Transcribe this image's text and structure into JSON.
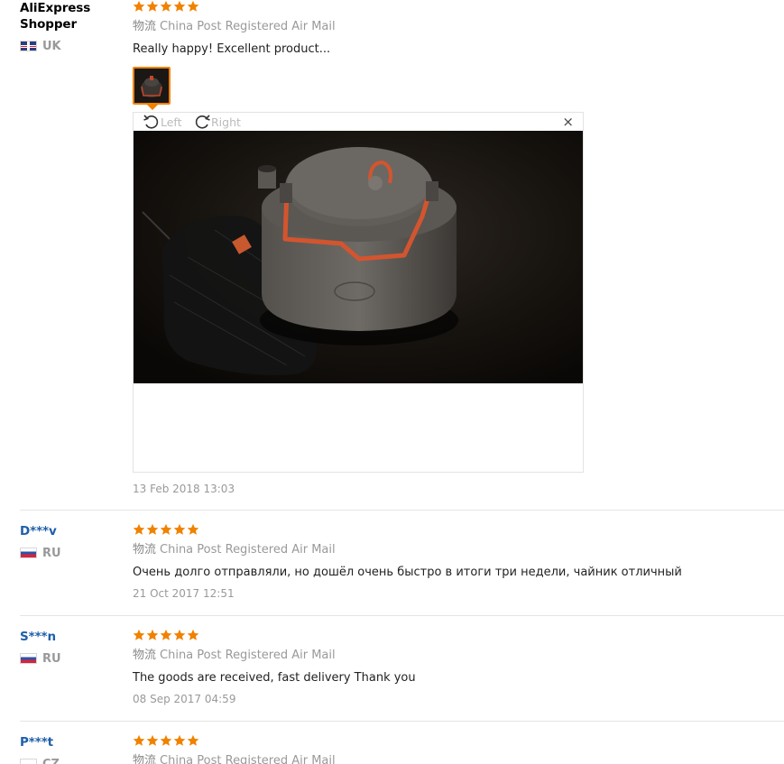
{
  "reviews": [
    {
      "username": "AliExpress Shopper",
      "country": "UK",
      "stars": 5,
      "logistics_cn": "物流",
      "logistics": "China Post Registered Air Mail",
      "feedback": "Really happy! Excellent product...",
      "date": "13 Feb 2018 13:03",
      "viewer": {
        "rotate_left": "Left",
        "rotate_right": "Right",
        "close": "×"
      }
    },
    {
      "username": "D***v",
      "country": "RU",
      "stars": 5,
      "logistics_cn": "物流",
      "logistics": "China Post Registered Air Mail",
      "feedback": "Очень долго отправляли, но дошёл очень быстро в итоги три недели, чайник отличный",
      "date": "21 Oct 2017 12:51"
    },
    {
      "username": "S***n",
      "country": "RU",
      "stars": 5,
      "logistics_cn": "物流",
      "logistics": "China Post Registered Air Mail",
      "feedback": "The goods are received, fast delivery Thank you",
      "date": "08 Sep 2017 04:59"
    },
    {
      "username": "P***t",
      "country": "CZ",
      "stars": 5,
      "logistics_cn": "物流",
      "logistics": "China Post Registered Air Mail"
    }
  ],
  "colors": {
    "star": "#f08200",
    "username_link": "#1f5fa8",
    "thumb_border": "#f08200",
    "muted_text": "#999999"
  },
  "icons": {
    "star": "star-icon",
    "rotate_left": "rotate-left-icon",
    "rotate_right": "rotate-right-icon",
    "close": "close-icon"
  }
}
